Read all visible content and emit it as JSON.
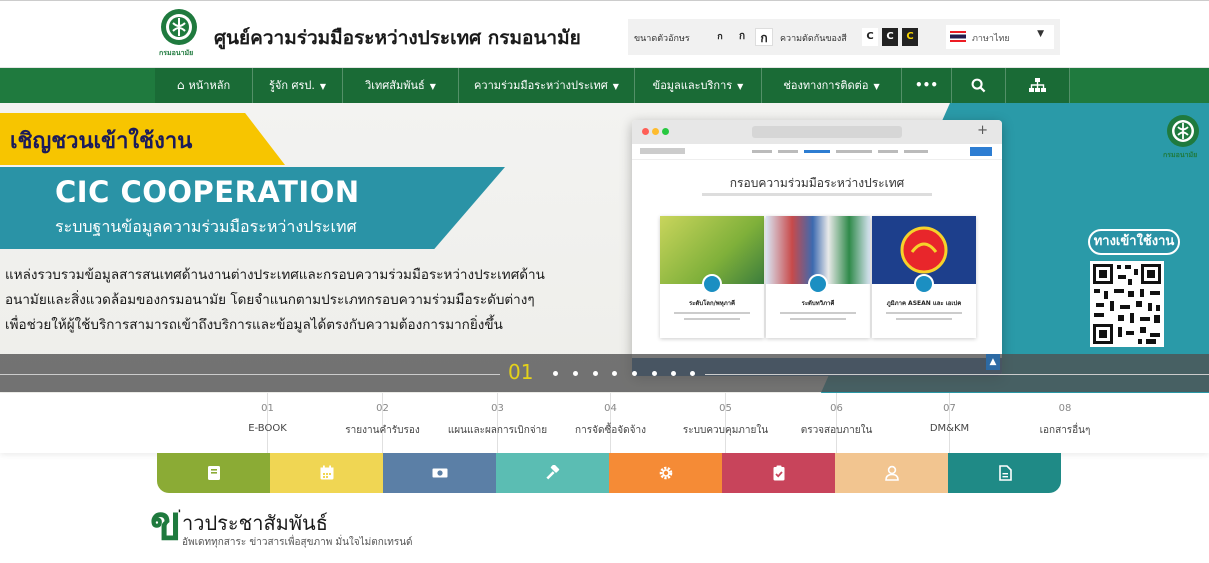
{
  "header": {
    "site_title": "ศูนย์ความร่วมมือระหว่างประเทศ กรมอนามัย",
    "logo_text": "กรมอนามัย",
    "font_size_label": "ขนาดตัวอักษร",
    "font_size_options": [
      "ก",
      "ก",
      "ก"
    ],
    "contrast_label": "ความตัดกันของสี",
    "contrast_options": [
      "C",
      "C",
      "C"
    ],
    "language": "ภาษาไทย"
  },
  "nav": {
    "items": [
      {
        "label": "หน้าหลัก"
      },
      {
        "label": "รู้จัก ศรป."
      },
      {
        "label": "วิเทศสัมพันธ์"
      },
      {
        "label": "ความร่วมมือระหว่างประเทศ"
      },
      {
        "label": "ข้อมูลและบริการ"
      },
      {
        "label": "ช่องทางการติดต่อ"
      }
    ],
    "more": "•••"
  },
  "banner": {
    "badge": "เชิญชวนเข้าใช้งาน",
    "title": "CIC COOPERATION",
    "subtitle": "ระบบฐานข้อมูลความร่วมมือระหว่างประเทศ",
    "desc": [
      "แหล่งรวบรวมข้อมูลสารสนเทศด้านงานต่างประเทศและกรอบความร่วมมือระหว่างประเทศด้าน",
      "อนามัยและสิ่งแวดล้อมของกรมอนามัย โดยจำแนกตามประเภทกรอบความร่วมมือระดับต่างๆ",
      "เพื่อช่วยให้ผู้ใช้บริการสามารถเข้าถึงบริการและข้อมูลได้ตรงกับความต้องการมากยิ่งขึ้น"
    ],
    "mock_title": "กรอบความร่วมมือระหว่างประเทศ",
    "mock_cards": [
      "ระดับโลก/พหุภาคี",
      "ระดับทวิภาคี",
      "ภูมิภาค ASEAN และ เอเปค"
    ],
    "gateway": "ทางเข้าใช้งาน",
    "slide_num": "01"
  },
  "menu": [
    {
      "num": "01",
      "label": "E-BOOK"
    },
    {
      "num": "02",
      "label": "รายงานคำรับรอง"
    },
    {
      "num": "03",
      "label": "แผนและผลการเบิกจ่าย"
    },
    {
      "num": "04",
      "label": "การจัดซื้อจัดจ้าง"
    },
    {
      "num": "05",
      "label": "ระบบควบคุมภายใน"
    },
    {
      "num": "06",
      "label": "ตรวจสอบภายใน"
    },
    {
      "num": "07",
      "label": "DM&KM"
    },
    {
      "num": "08",
      "label": "เอกสารอื่นๆ"
    }
  ],
  "tiles": [
    {
      "icon": "book-icon",
      "color": "#8bab35"
    },
    {
      "icon": "calendar-icon",
      "color": "#f0d653"
    },
    {
      "icon": "money-icon",
      "color": "#5b7fa6"
    },
    {
      "icon": "gavel-icon",
      "color": "#5bbdb3"
    },
    {
      "icon": "gear-icon",
      "color": "#f58b36"
    },
    {
      "icon": "clipboard-check-icon",
      "color": "#c8445b"
    },
    {
      "icon": "user-icon",
      "color": "#f2c590"
    },
    {
      "icon": "document-icon",
      "color": "#1f8a86"
    }
  ],
  "news": {
    "letter": "ข",
    "title": "่าวประชาสัมพันธ์",
    "subtitle": "อัพเดททุกสาระ ข่าวสารเพื่อสุขภาพ มั่นใจไม่ตกเทรนด์"
  },
  "colors": {
    "nav_green": "#1a6b36",
    "teal": "#2a93a6",
    "yellow": "#f7c500"
  }
}
